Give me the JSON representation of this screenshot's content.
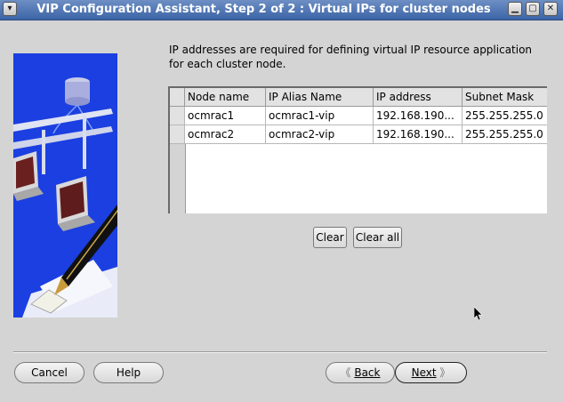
{
  "window": {
    "title": "VIP Configuration Assistant, Step 2 of 2 : Virtual IPs for cluster nodes"
  },
  "instructions": "IP addresses are required for defining virtual IP resource application for each cluster node.",
  "table": {
    "columns": [
      "Node name",
      "IP Alias Name",
      "IP address",
      "Subnet Mask"
    ],
    "rows": [
      [
        "ocmrac1",
        "ocmrac1-vip",
        "192.168.190...",
        "255.255.255.0"
      ],
      [
        "ocmrac2",
        "ocmrac2-vip",
        "192.168.190...",
        "255.255.255.0"
      ]
    ]
  },
  "buttons": {
    "clear": "Clear",
    "clear_all": "Clear all",
    "cancel": "Cancel",
    "help": "Help",
    "back": "Back",
    "next": "Next"
  },
  "colors": {
    "titlebar": "#3c64a6",
    "illustration_bg": "#1b3fe0",
    "window_bg": "#d4d4d4"
  }
}
